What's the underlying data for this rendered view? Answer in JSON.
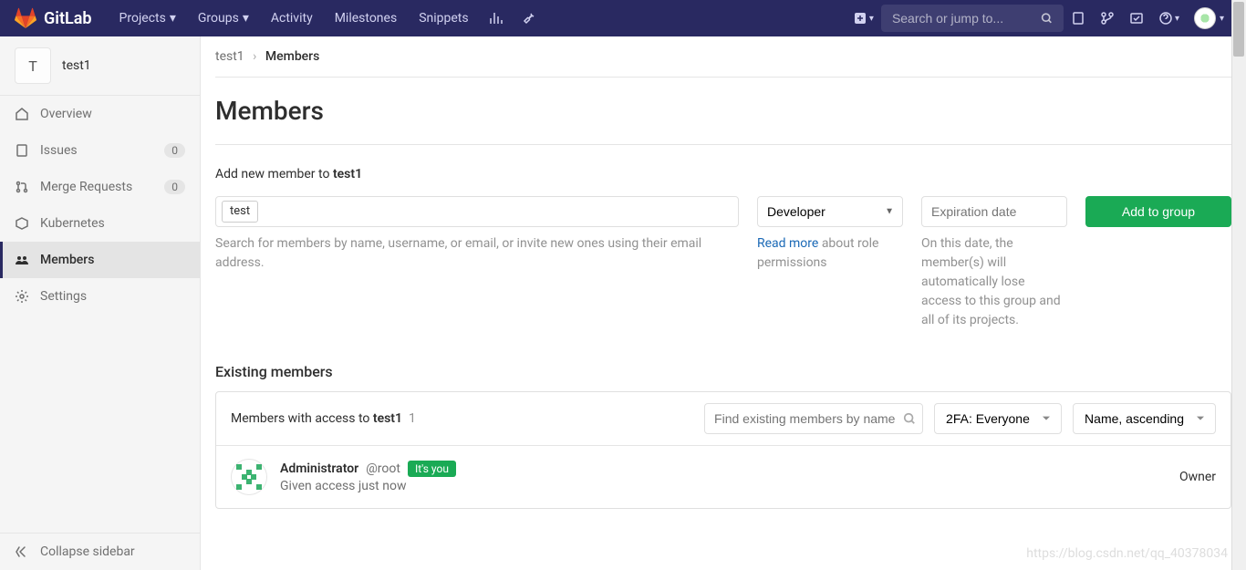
{
  "topbar": {
    "brand": "GitLab",
    "links": [
      "Projects",
      "Groups",
      "Activity",
      "Milestones",
      "Snippets"
    ],
    "search_placeholder": "Search or jump to..."
  },
  "sidebar": {
    "group_letter": "T",
    "group_name": "test1",
    "items": [
      {
        "icon": "home",
        "label": "Overview"
      },
      {
        "icon": "issues",
        "label": "Issues",
        "count": "0"
      },
      {
        "icon": "merge",
        "label": "Merge Requests",
        "count": "0"
      },
      {
        "icon": "kube",
        "label": "Kubernetes"
      },
      {
        "icon": "members",
        "label": "Members",
        "active": true
      },
      {
        "icon": "settings",
        "label": "Settings"
      }
    ],
    "collapse_label": "Collapse sidebar"
  },
  "breadcrumb": {
    "root": "test1",
    "current": "Members"
  },
  "page": {
    "title": "Members",
    "add_label_prefix": "Add new member to ",
    "add_label_group": "test1",
    "member_chip": "test",
    "member_help": "Search for members by name, username, or email, or invite new ones using their email address.",
    "role_selected": "Developer",
    "role_link": "Read more",
    "role_help_rest": " about role permissions",
    "date_placeholder": "Expiration date",
    "date_help": "On this date, the member(s) will automatically lose access to this group and all of its projects.",
    "add_button": "Add to group",
    "existing_title": "Existing members",
    "toolbar_label_prefix": "Members with access to ",
    "toolbar_label_group": "test1",
    "toolbar_label_count": "1",
    "find_placeholder": "Find existing members by name",
    "filter_2fa": "2FA: Everyone",
    "sort": "Name, ascending"
  },
  "member": {
    "name": "Administrator",
    "username": "@root",
    "badge": "It's you",
    "subtext": "Given access just now",
    "role": "Owner"
  },
  "watermark": "https://blog.csdn.net/qq_40378034"
}
